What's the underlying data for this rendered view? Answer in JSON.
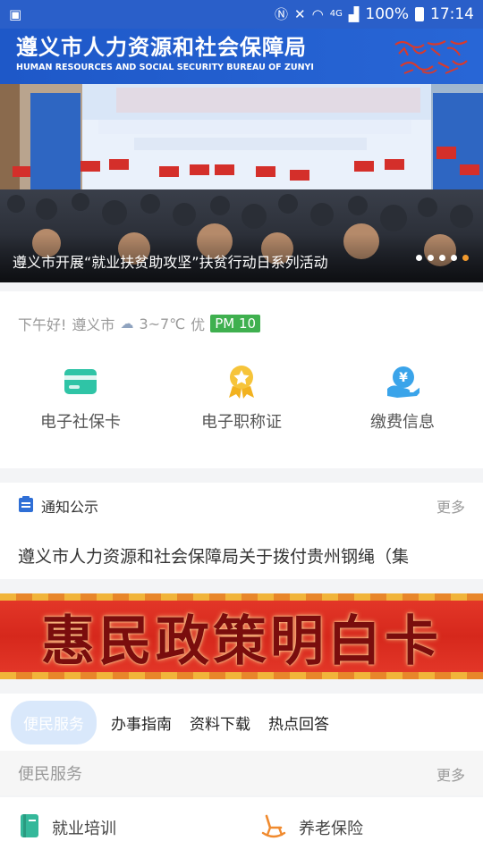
{
  "status_bar": {
    "battery": "100%",
    "time": "17:14",
    "network": "4G"
  },
  "header": {
    "title": "遵义市人力资源和社会保障局",
    "subtitle": "HUMAN RESOURCES AND SOCIAL SECURITY BUREAU OF ZUNYI"
  },
  "banner": {
    "caption": "遵义市开展“就业扶贫助攻坚”扶贫行动日系列活动",
    "slide_count": 5,
    "active_slide": 5
  },
  "weather": {
    "greeting": "下午好!",
    "city": "遵义市",
    "temperature": "3~7℃",
    "air_quality": "优",
    "pm": "PM 10"
  },
  "quick_actions": [
    {
      "label": "电子社保卡",
      "icon": "card-icon"
    },
    {
      "label": "电子职称证",
      "icon": "medal-icon"
    },
    {
      "label": "缴费信息",
      "icon": "yuan-hand-icon"
    }
  ],
  "notice": {
    "title": "通知公示",
    "more": "更多",
    "text": "遵义市人力资源和社会保障局关于拨付贵州钢绳（集"
  },
  "policy_banner": {
    "text": "惠民政策明白卡"
  },
  "tabs": [
    {
      "label": "便民服务",
      "active": true
    },
    {
      "label": "办事指南",
      "active": false
    },
    {
      "label": "资料下载",
      "active": false
    },
    {
      "label": "热点回答",
      "active": false
    }
  ],
  "services_section": {
    "title": "便民服务",
    "more": "更多",
    "items": [
      {
        "label": "就业培训",
        "icon": "book-icon"
      },
      {
        "label": "养老保险",
        "icon": "rocking-chair-icon"
      }
    ]
  },
  "colors": {
    "header_blue": "#2866d6",
    "accent_orange": "#f29a2e",
    "pm_green": "#3fb04f",
    "policy_red": "#e5392a"
  }
}
